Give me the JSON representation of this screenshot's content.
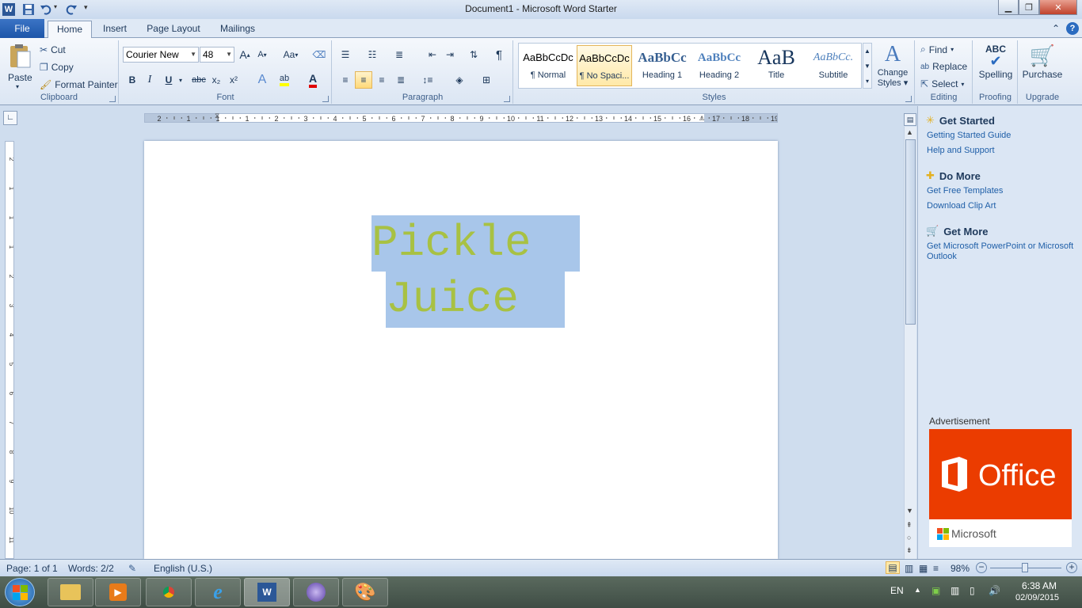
{
  "window": {
    "title": "Document1  -  Microsoft Word Starter"
  },
  "tabs": [
    "File",
    "Home",
    "Insert",
    "Page Layout",
    "Mailings"
  ],
  "clipboard": {
    "paste_label": "Paste",
    "cut_label": "Cut",
    "copy_label": "Copy",
    "format_painter_label": "Format Painter",
    "group_label": "Clipboard"
  },
  "font": {
    "family": "Courier New",
    "size": "48",
    "group_label": "Font",
    "bold": "B",
    "italic": "I",
    "underline": "U",
    "strike": "abc",
    "subscript": "x₂",
    "superscript": "x²",
    "grow": "A",
    "shrink": "A",
    "change_case": "Aa"
  },
  "paragraph": {
    "group_label": "Paragraph",
    "pilcrow": "¶"
  },
  "styles": {
    "group_label": "Styles",
    "items": [
      {
        "sample": "AaBbCcDc",
        "name": "¶ Normal"
      },
      {
        "sample": "AaBbCcDc",
        "name": "¶ No Spaci..."
      },
      {
        "sample": "AaBbCc",
        "name": "Heading 1"
      },
      {
        "sample": "AaBbCc",
        "name": "Heading 2"
      },
      {
        "sample": "AaB",
        "name": "Title"
      },
      {
        "sample": "AaBbCc.",
        "name": "Subtitle"
      }
    ],
    "change_styles_line1": "Change",
    "change_styles_line2": "Styles"
  },
  "editing": {
    "group_label": "Editing",
    "find_label": "Find",
    "replace_label": "Replace",
    "select_label": "Select"
  },
  "proofing": {
    "group_label": "Proofing",
    "spelling_label": "Spelling",
    "spelling_icon": "ABC"
  },
  "upgrade": {
    "group_label": "Upgrade",
    "purchase_label": "Purchase"
  },
  "document": {
    "line1": "Pickle ",
    "line2": "Juice ",
    "text_color": "#a8c143",
    "highlight_color": "#a8c6ea"
  },
  "ruler": {
    "top_numbers": [
      "2",
      "1",
      "1",
      "1",
      "2",
      "3",
      "4",
      "5",
      "6",
      "7",
      "8",
      "9",
      "10",
      "11",
      "12",
      "13",
      "14",
      "15",
      "16",
      "17",
      "18",
      "19"
    ],
    "left_numbers": [
      "2",
      "1",
      "1",
      "1",
      "2",
      "3",
      "4",
      "5",
      "6",
      "7",
      "8",
      "9",
      "10",
      "11"
    ]
  },
  "pane": {
    "get_started": "Get Started",
    "getting_started_guide": "Getting Started Guide",
    "help_support": "Help and Support",
    "do_more": "Do More",
    "free_templates": "Get Free Templates",
    "clip_art": "Download Clip Art",
    "get_more": "Get More",
    "get_ppt": "Get Microsoft PowerPoint or Microsoft Outlook",
    "advertisement": "Advertisement",
    "ad_office": "Office",
    "ad_microsoft": "Microsoft"
  },
  "status": {
    "page": "Page: 1 of 1",
    "words": "Words: 2/2",
    "language": "English (U.S.)",
    "zoom": "98%"
  },
  "taskbar": {
    "language": "EN",
    "time": "6:38 AM",
    "date": "02/09/2015"
  }
}
